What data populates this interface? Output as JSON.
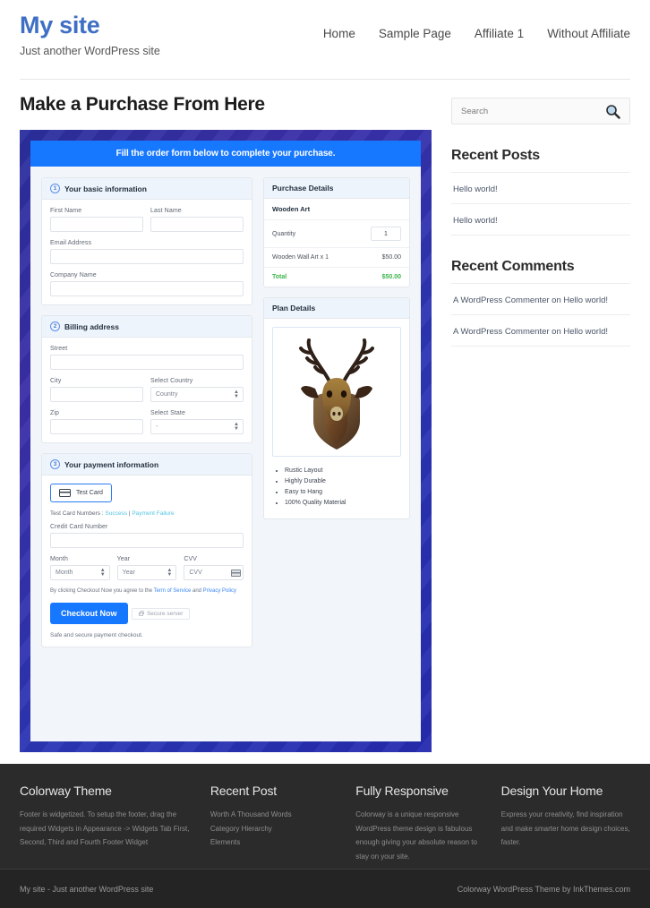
{
  "header": {
    "site_title": "My site",
    "tagline": "Just another WordPress site",
    "nav": [
      {
        "label": "Home"
      },
      {
        "label": "Sample Page"
      },
      {
        "label": "Affiliate 1"
      },
      {
        "label": "Without Affiliate"
      }
    ]
  },
  "main": {
    "page_title": "Make a Purchase From Here",
    "banner": "Fill the order form below to complete your purchase.",
    "accent_blue": "#1677ff",
    "basic": {
      "step": "1",
      "title": "Your basic information",
      "first_name_label": "First Name",
      "first_name_value": "",
      "last_name_label": "Last Name",
      "last_name_value": "",
      "email_label": "Email Address",
      "email_value": "",
      "company_label": "Company Name",
      "company_value": ""
    },
    "billing": {
      "step": "2",
      "title": "Billing address",
      "street_label": "Street",
      "street_value": "",
      "city_label": "City",
      "city_value": "",
      "country_label": "Select Country",
      "country_value": "Country",
      "zip_label": "Zip",
      "zip_value": "",
      "state_label": "Select State",
      "state_value": "-"
    },
    "payment": {
      "step": "3",
      "title": "Your payment information",
      "card_tab": "Test Card",
      "test_prefix": "Test Card Numbers :",
      "test_success": "Success",
      "test_separator": "|",
      "test_failure": "Payment Failure",
      "ccnum_label": "Credit Card Number",
      "ccnum_value": "",
      "month_label": "Month",
      "month_value": "Month",
      "year_label": "Year",
      "year_value": "Year",
      "cvv_label": "CVV",
      "cvv_value": "CVV",
      "terms_prefix": "By clicking Checkout Now you agree to the",
      "terms_link": "Term of Service",
      "terms_and": "and",
      "privacy_link": "Privacy Policy",
      "checkout_label": "Checkout Now",
      "secure_badge": "Secure server",
      "safe_note": "Safe and secure payment checkout."
    },
    "purchase_details": {
      "title": "Purchase Details",
      "product": "Wooden Art",
      "quantity_label": "Quantity",
      "quantity_value": "1",
      "line_item": "Wooden Wall Art x 1",
      "line_price": "$50.00",
      "total_label": "Total",
      "total_price": "$50.00",
      "total_color": "#3bb54a"
    },
    "plan_details": {
      "title": "Plan Details",
      "image_alt": "mounted-deer-head-wall-art",
      "features": [
        "Rustic Layout",
        "Highly Durable",
        "Easy to Hang",
        "100% Quality Material"
      ]
    }
  },
  "sidebar": {
    "search": {
      "placeholder": "Search",
      "value": ""
    },
    "recent_posts": {
      "title": "Recent Posts",
      "items": [
        "Hello world!",
        "Hello world!"
      ]
    },
    "recent_comments": {
      "title": "Recent Comments",
      "items": [
        "A WordPress Commenter on Hello world!",
        "A WordPress Commenter on Hello world!"
      ]
    }
  },
  "footer": {
    "columns": [
      {
        "title": "Colorway Theme",
        "text": "Footer is widgetized. To setup the footer, drag the required Widgets in Appearance -> Widgets Tab First, Second, Third and Fourth Footer Widget"
      },
      {
        "title": "Recent Post",
        "items": [
          "Worth A Thousand Words",
          "Category Hierarchy",
          "Elements"
        ]
      },
      {
        "title": "Fully Responsive",
        "text": "Colorway is a unique responsive WordPress theme design is fabulous enough giving your absolute reason to stay on your site."
      },
      {
        "title": "Design Your Home",
        "text": "Express your creativity, find inspiration and make smarter home design choices, faster."
      }
    ],
    "bottom_left": "My site - Just another WordPress site",
    "bottom_right": "Colorway WordPress Theme by InkThemes.com"
  }
}
